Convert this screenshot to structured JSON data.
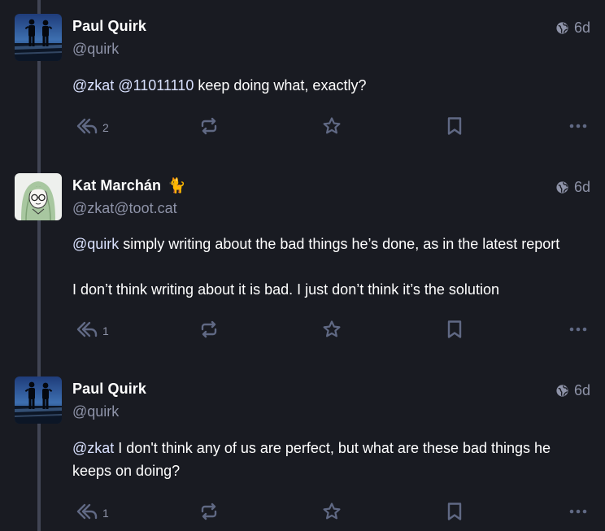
{
  "posts": [
    {
      "name": "Paul Quirk",
      "emoji": "",
      "handle": "@quirk",
      "time": "6d",
      "paragraphs": [
        [
          {
            "t": "@zkat",
            "m": true
          },
          {
            "t": " ",
            "m": false
          },
          {
            "t": "@11011110",
            "m": true
          },
          {
            "t": " keep doing what, exactly?",
            "m": false
          }
        ]
      ],
      "reply_count": "2",
      "avatar": "paul"
    },
    {
      "name": "Kat Marchán",
      "emoji": "🐈",
      "handle": "@zkat@toot.cat",
      "time": "6d",
      "paragraphs": [
        [
          {
            "t": "@quirk",
            "m": true
          },
          {
            "t": " simply writing about the bad things he’s done, as in the latest report",
            "m": false
          }
        ],
        [
          {
            "t": "I don’t think writing about it is bad. I just don’t think it’s the solution",
            "m": false
          }
        ]
      ],
      "reply_count": "1",
      "avatar": "kat"
    },
    {
      "name": "Paul Quirk",
      "emoji": "",
      "handle": "@quirk",
      "time": "6d",
      "paragraphs": [
        [
          {
            "t": "@zkat",
            "m": true
          },
          {
            "t": " I don't think any of us are perfect, but what are these bad things he keeps on doing?",
            "m": false
          }
        ]
      ],
      "reply_count": "1",
      "avatar": "paul"
    }
  ],
  "icons": {
    "visibility": "globe-icon",
    "reply": "reply-all-icon",
    "boost": "boost-icon",
    "favourite": "star-icon",
    "bookmark": "bookmark-icon",
    "more": "more-icon"
  },
  "colors": {
    "background": "#191b22",
    "thread_line": "#414554",
    "muted_text": "#8e93a8",
    "action_icon": "#606984",
    "mention": "#d9e1ff"
  }
}
